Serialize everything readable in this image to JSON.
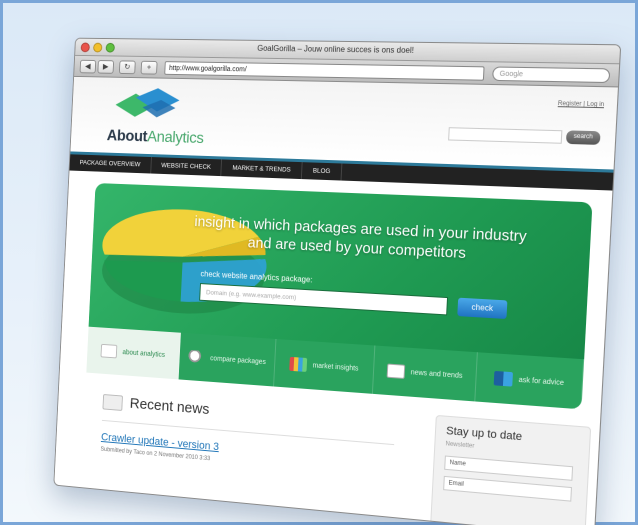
{
  "window": {
    "title": "GoalGorilla – Jouw online succes is ons doel!",
    "url": "http://www.goalgorilla.com/",
    "search_placeholder": "Google",
    "back_label": "◀",
    "forward_label": "▶",
    "reload_label": "↻",
    "add_label": "+"
  },
  "header": {
    "brand_bold": "About",
    "brand_light": "Analytics",
    "reg_links": "Register | Log in",
    "search_button": "search"
  },
  "nav": {
    "items": [
      "PACKAGE OVERVIEW",
      "WEBSITE CHECK",
      "MARKET & TRENDS",
      "BLOG"
    ]
  },
  "hero": {
    "headline_line1": "insight in which packages are used in your industry",
    "headline_line2": "and are used by your competitors",
    "check_label": "check website analytics package:",
    "domain_placeholder": "Domain (e.g. www.example.com)",
    "check_button": "check"
  },
  "tabs": [
    {
      "label": "about analytics",
      "icon": "document-icon"
    },
    {
      "label": "compare packages",
      "icon": "magnifier-icon"
    },
    {
      "label": "market insights",
      "icon": "bar-chart-icon"
    },
    {
      "label": "news and trends",
      "icon": "newspaper-icon"
    },
    {
      "label": "ask for advice",
      "icon": "people-icon"
    }
  ],
  "recent_news": {
    "title": "Recent news",
    "item_title": "Crawler update - version 3",
    "item_meta": "Submitted by Taco on 2 November 2010 3:33"
  },
  "sidebar": {
    "title": "Stay up to date",
    "subtitle": "Newsletter",
    "name_placeholder": "Name",
    "email_placeholder": "Email"
  },
  "colors": {
    "accent_green": "#2aa35e",
    "link_blue": "#2176b8",
    "button_blue": "#1f73c2"
  }
}
